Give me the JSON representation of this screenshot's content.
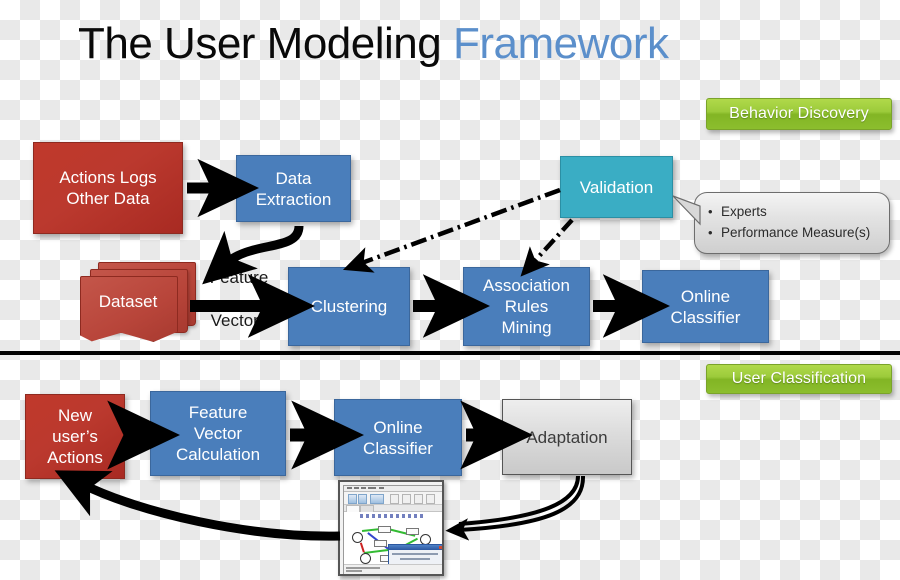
{
  "title": {
    "primary": "The User Modeling",
    "accent": " Framework"
  },
  "badges": {
    "behavior_discovery": "Behavior Discovery",
    "user_classification": "User Classification"
  },
  "behavior_discovery": {
    "actions_logs": "Actions Logs\nOther Data",
    "data_extraction": "Data\nExtraction",
    "validation": "Validation",
    "dataset": "Dataset",
    "feature_label_line1": "Feature",
    "feature_label_line2": "Vectors",
    "clustering": "Clustering",
    "association_rules_mining": "Association\nRules\nMining",
    "online_classifier": "Online\nClassifier"
  },
  "callout": {
    "items": [
      "Experts",
      "Performance Measure(s)"
    ]
  },
  "user_classification": {
    "new_users_actions": "New\nuser’s\nActions",
    "feature_vector_calculation": "Feature\nVector\nCalculation",
    "online_classifier": "Online\nClassifier",
    "adaptation": "Adaptation"
  },
  "colors": {
    "red": "#bb392e",
    "blue": "#4a7ebb",
    "teal": "#3aadc4",
    "grey": "#dcdcdc",
    "green_badge": "#9ccb3b",
    "title_accent": "#5b8fcb",
    "arrow": "#000000"
  },
  "icons": {
    "thumbnail": "application-window-screenshot-thumbnail"
  }
}
